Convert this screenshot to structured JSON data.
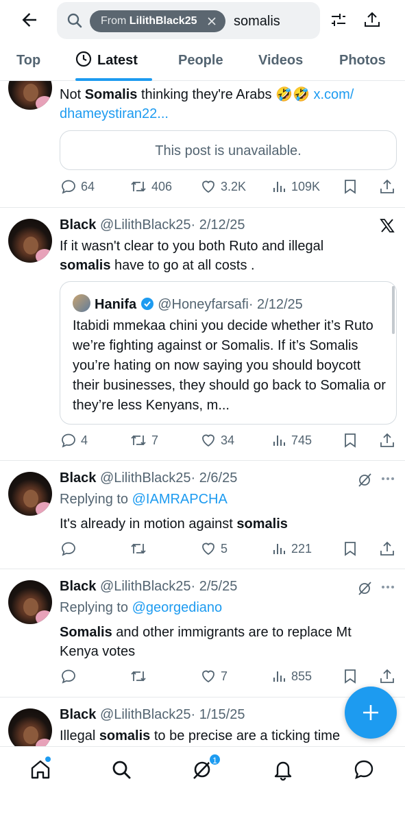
{
  "search": {
    "chip_from": "From",
    "chip_user": "LilithBlack25",
    "query": "somalis"
  },
  "tabs": [
    {
      "label": "Top",
      "active": false
    },
    {
      "label": "Latest",
      "active": true
    },
    {
      "label": "People",
      "active": false
    },
    {
      "label": "Videos",
      "active": false
    },
    {
      "label": "Photos",
      "active": false
    }
  ],
  "posts": [
    {
      "text_parts": [
        "Not ",
        "Somalis",
        " thinking they're Arabs 🤣🤣 ",
        "x.com/",
        "dhameystiran22..."
      ],
      "card_text": "This post is unavailable.",
      "stats": {
        "replies": "64",
        "reposts": "406",
        "likes": "3.2K",
        "views": "109K"
      }
    },
    {
      "name": "Black",
      "handle": "@LilithBlack25",
      "date": "· 2/12/25",
      "text_parts": [
        "If it wasn't clear to you  both Ruto and illegal",
        "somalis",
        " have to go at all costs ."
      ],
      "quote": {
        "name": "Hanifa",
        "handle": "@Honeyfarsafi",
        "date": "· 2/12/25",
        "text": "Itabidi mmekaa chini you decide whether it’s Ruto we’re fighting against or Somalis. If it’s Somalis you’re hating on now saying you should boycott their businesses, they should go back to Somalia or they’re less Kenyans, m..."
      },
      "stats": {
        "replies": "4",
        "reposts": "7",
        "likes": "34",
        "views": "745"
      }
    },
    {
      "name": "Black",
      "handle": "@LilithBlack25",
      "date": "· 2/6/25",
      "replying_label": "Replying to",
      "replying_to": "@IAMRAPCHA",
      "text_parts": [
        "It's already in motion against ",
        "somalis"
      ],
      "stats": {
        "replies": "",
        "reposts": "",
        "likes": "5",
        "views": "221"
      }
    },
    {
      "name": "Black",
      "handle": "@LilithBlack25",
      "date": "· 2/5/25",
      "replying_label": "Replying to",
      "replying_to": "@georgediano",
      "text_parts": [
        "Somalis",
        " and other immigrants are to replace Mt",
        "Kenya votes"
      ],
      "stats": {
        "replies": "",
        "reposts": "",
        "likes": "7",
        "views": "855"
      }
    },
    {
      "name": "Black",
      "handle": "@LilithBlack25",
      "date": "· 1/15/25",
      "text_parts": [
        "Illegal ",
        "somalis",
        " to be precise are a ticking time"
      ]
    }
  ],
  "bottom_nav": {
    "messages_badge": "1"
  },
  "colors": {
    "accent": "#1d9bf0",
    "text": "#0f1419",
    "muted": "#536471"
  }
}
